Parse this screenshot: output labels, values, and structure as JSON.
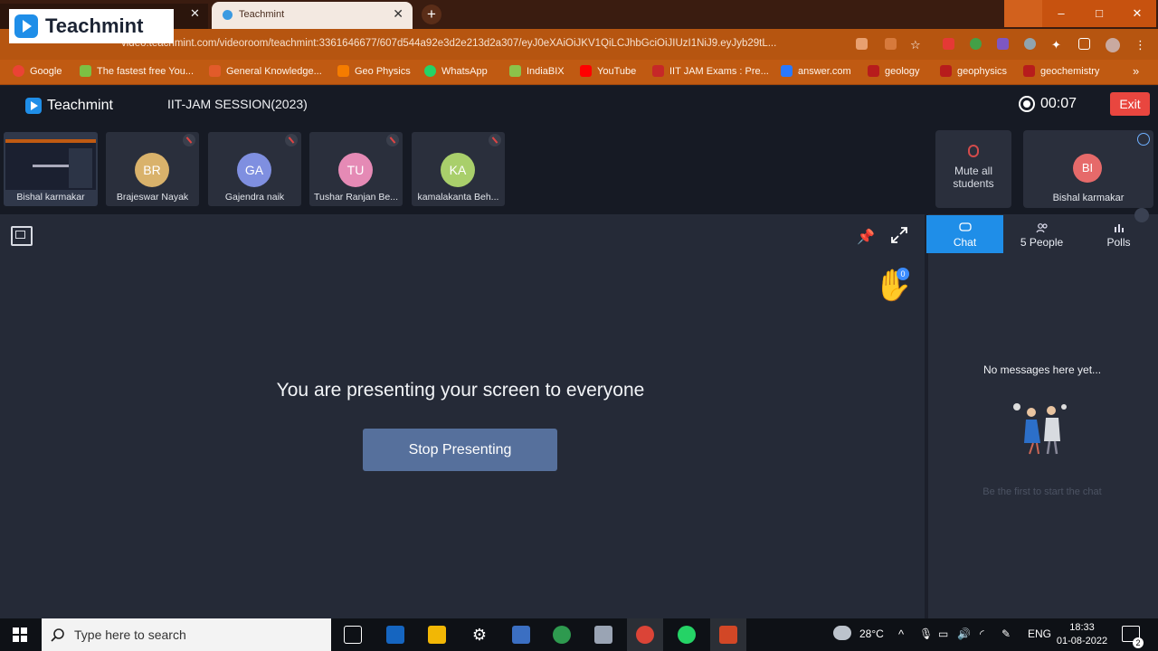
{
  "browser": {
    "tab_title": "Teachmint",
    "url": "video.teachmint.com/videoroom/teachmint:3361646677/607d544a92e3d2e213d2a307/eyJ0eXAiOiJKV1QiLCJhbGciOiJIUzI1NiJ9.eyJyb29tL...",
    "bookmarks": [
      {
        "label": "Google",
        "color": "#ea4335"
      },
      {
        "label": "The fastest free You...",
        "color": "#7cc043"
      },
      {
        "label": "General Knowledge...",
        "color": "#e25b2a"
      },
      {
        "label": "Geo Physics",
        "color": "#f57c00"
      },
      {
        "label": "WhatsApp",
        "color": "#25d366"
      },
      {
        "label": "IndiaBIX",
        "color": "#8bc34a"
      },
      {
        "label": "YouTube",
        "color": "#ff0000"
      },
      {
        "label": "IIT JAM Exams : Pre...",
        "color": "#c62828"
      },
      {
        "label": "answer.com",
        "color": "#2979ff"
      },
      {
        "label": "geology",
        "color": "#b71c1c"
      },
      {
        "label": "geophysics",
        "color": "#b71c1c"
      },
      {
        "label": "geochemistry",
        "color": "#b71c1c"
      }
    ],
    "window_controls": [
      "–",
      "□",
      "✕"
    ]
  },
  "overlay_logo": {
    "text": "Teachmint"
  },
  "app": {
    "brand": "Teachmint",
    "session_title": "IIT-JAM SESSION(2023)",
    "timer": "00:07",
    "exit_label": "Exit"
  },
  "participants": {
    "self_name": "Bishal karmakar",
    "tiles": [
      {
        "initials": "BR",
        "name": "Brajeswar Nayak",
        "color": "#d9b26b"
      },
      {
        "initials": "GA",
        "name": "Gajendra naik",
        "color": "#7f8fe0"
      },
      {
        "initials": "TU",
        "name": "Tushar Ranjan Be...",
        "color": "#e58ab5"
      },
      {
        "initials": "KA",
        "name": "kamalakanta Beh...",
        "color": "#a9cf6b"
      }
    ],
    "mute_all_label": "Mute all students",
    "host": {
      "initials": "BI",
      "name": "Bishal karmakar"
    }
  },
  "stage": {
    "message": "You are presenting your screen to everyone",
    "stop_label": "Stop Presenting",
    "hand_count": "0"
  },
  "panel": {
    "tabs": [
      {
        "label": "Chat",
        "active": true
      },
      {
        "label": "5 People",
        "active": false
      },
      {
        "label": "Polls",
        "active": false
      }
    ],
    "empty_title": "No messages here yet...",
    "empty_sub": "Be the first to start the chat"
  },
  "taskbar": {
    "search_placeholder": "Type here to search",
    "weather": "28°C",
    "lang": "ENG",
    "time": "18:33",
    "date": "01-08-2022",
    "notif_count": "2"
  },
  "colors": {
    "brand_blue": "#1f8ee8",
    "exit_red": "#e9463f",
    "stop_button": "#56709c"
  }
}
